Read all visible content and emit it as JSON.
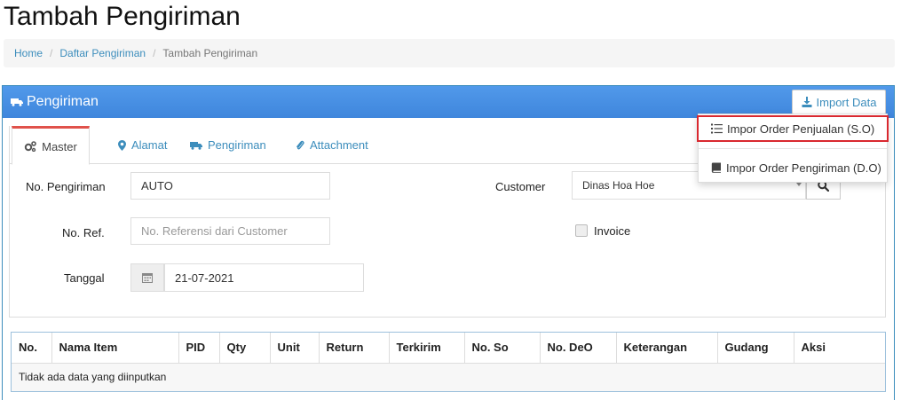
{
  "page": {
    "title": "Tambah Pengiriman"
  },
  "breadcrumb": {
    "items": [
      "Home",
      "Daftar Pengiriman",
      "Tambah Pengiriman"
    ],
    "separator": "/"
  },
  "panel": {
    "title": "Pengiriman",
    "header_color": "#4a90e2",
    "import_button": "Import Data"
  },
  "import_menu": {
    "items": [
      "Impor Order Penjualan (S.O)",
      "Impor Order Pengiriman (D.O)"
    ],
    "highlight_color": "#d9282f"
  },
  "tabs": [
    {
      "label": "Master",
      "icon": "cogs-icon",
      "active": true
    },
    {
      "label": "Alamat",
      "icon": "map-marker-icon",
      "active": false
    },
    {
      "label": "Pengiriman",
      "icon": "truck-icon",
      "active": false
    },
    {
      "label": "Attachment",
      "icon": "paperclip-icon",
      "active": false
    }
  ],
  "form": {
    "no_pengiriman": {
      "label": "No. Pengiriman",
      "value": "AUTO"
    },
    "no_ref": {
      "label": "No. Ref.",
      "placeholder": "No. Referensi dari Customer"
    },
    "tanggal": {
      "label": "Tanggal",
      "value": "21-07-2021"
    },
    "customer": {
      "label": "Customer",
      "value": "Dinas Hoa Hoe"
    },
    "invoice": {
      "label": "Invoice",
      "checked": false
    }
  },
  "table": {
    "columns": [
      "No.",
      "Nama Item",
      "PID",
      "Qty",
      "Unit",
      "Return",
      "Terkirim",
      "No. So",
      "No. DeO",
      "Keterangan",
      "Gudang",
      "Aksi"
    ],
    "empty_message": "Tidak ada data yang diinputkan"
  }
}
